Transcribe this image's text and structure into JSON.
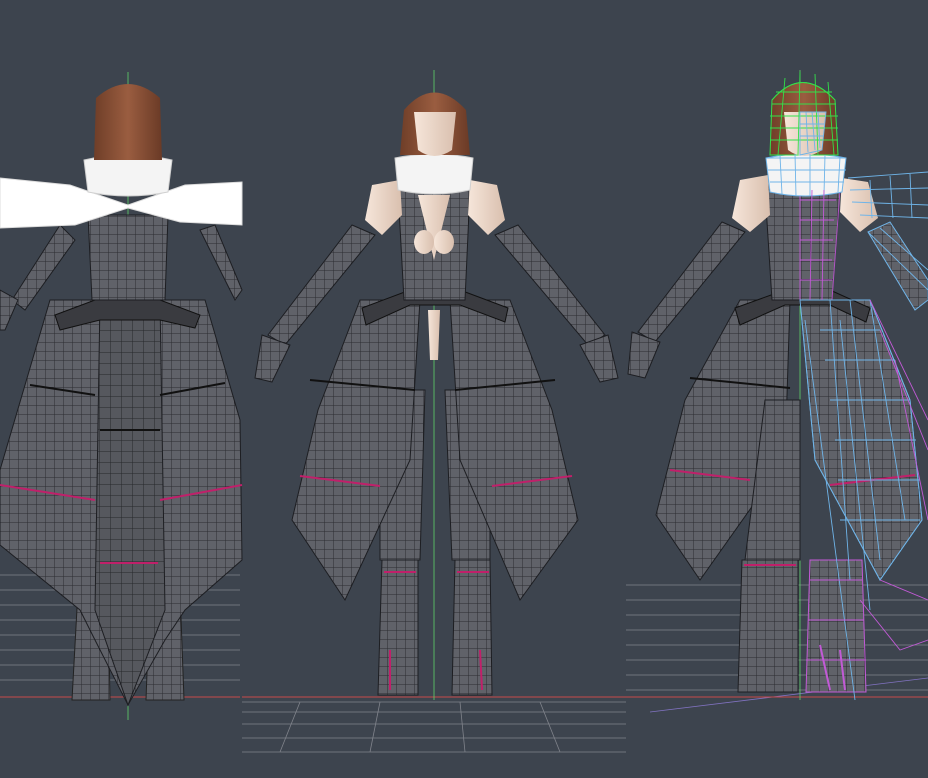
{
  "scene": {
    "background": "#3d444e",
    "views": [
      {
        "name": "back",
        "label": "",
        "icon": "back-view-model-icon"
      },
      {
        "name": "front",
        "label": "",
        "icon": "front-view-model-icon"
      },
      {
        "name": "wireframe",
        "label": "",
        "icon": "wireframe-overlay-model-icon"
      }
    ],
    "colors": {
      "cloth": "#5f6168",
      "cloth_grid": "#2a2b30",
      "seam_accent": "#c0206a",
      "skin": "#f0dccf",
      "hair": "#8a5238",
      "scarf": "#f4f4f4",
      "axis_green": "#5fd36a",
      "axis_red": "#c84a4a",
      "ground_grid": "#8c8f96",
      "wire_blue": "#6fb4e8",
      "wire_magenta": "#c25ad6",
      "wire_green": "#33e04a"
    }
  }
}
